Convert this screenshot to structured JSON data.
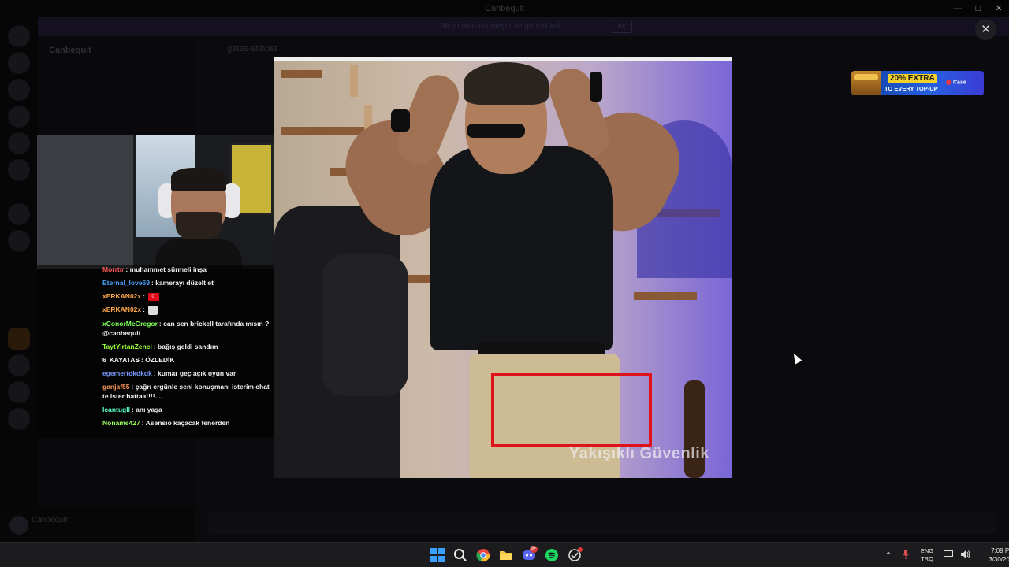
{
  "background_app": {
    "title": "Canbequit",
    "server_name": "Canbequit",
    "channel_name": "gates-sohbet",
    "notice_text": "Bildirimleri etkinleştir ve güncel kal",
    "notice_button": "Aç"
  },
  "webcam": {
    "description_label": "streamer webcam"
  },
  "chat": {
    "messages": [
      {
        "user": "Morrtır",
        "user_color": "#ff5a5a",
        "text": ": muhammet sürmeli inşa"
      },
      {
        "user": "Eternal_love69",
        "user_color": "#4aa3ff",
        "text": ": kamerayı düzelt et"
      },
      {
        "user": "xERKAN02x",
        "user_color": "#ffa64a",
        "text": ":",
        "emote": "flag"
      },
      {
        "user": "xERKAN02x",
        "user_color": "#ffa64a",
        "text": ":",
        "emote": "face"
      },
      {
        "user": "xConorMcGregor",
        "user_color": "#7cff5a",
        "text": ": can sen brickell tarafında mısın ? @canbequit"
      },
      {
        "user": "TaytYirtanZenci",
        "user_color": "#9aff3a",
        "text": ": bağış geldi sandım"
      },
      {
        "user": "KAYATAS",
        "user_color": "#ffffff",
        "text": ": ÖZLEDİK",
        "prefix": "6"
      },
      {
        "user": "egemertdkdkdk",
        "user_color": "#7a9cff",
        "text": ": kumar geç açık oyun var"
      },
      {
        "user": "ganjaf55",
        "user_color": "#ff9a5a",
        "text": ": çağrı ergünle seni konuşmanı isterim chat te ister hattaa!!!!...."
      },
      {
        "user": "Icantugll",
        "user_color": "#5affc8",
        "text": ": anı yaşa"
      },
      {
        "user": "Noname427",
        "user_color": "#9aff5a",
        "text": ": Asensio kaçacak fenerden"
      }
    ]
  },
  "preview": {
    "watermark": "Yakışıklı Güvenlik"
  },
  "modal": {
    "close_symbol": "✕"
  },
  "ad": {
    "extra": "20% EXTRA",
    "topup": "TO EVERY TOP-UP",
    "brand": "Case"
  },
  "taskbar": {
    "apps": [
      {
        "name": "start-button",
        "icon": "windows-icon"
      },
      {
        "name": "search-button",
        "icon": "search-icon"
      },
      {
        "name": "chrome-button",
        "icon": "chrome-icon"
      },
      {
        "name": "file-explorer-button",
        "icon": "folder-icon"
      },
      {
        "name": "discord-button",
        "icon": "discord-icon",
        "badge": "9+"
      },
      {
        "name": "spotify-button",
        "icon": "spotify-icon"
      },
      {
        "name": "app-button",
        "icon": "app-icon",
        "dot": true
      }
    ],
    "lang_line1": "ENG",
    "lang_line2": "TRQ",
    "time": "7:09 PM",
    "date": "3/30/2026"
  }
}
